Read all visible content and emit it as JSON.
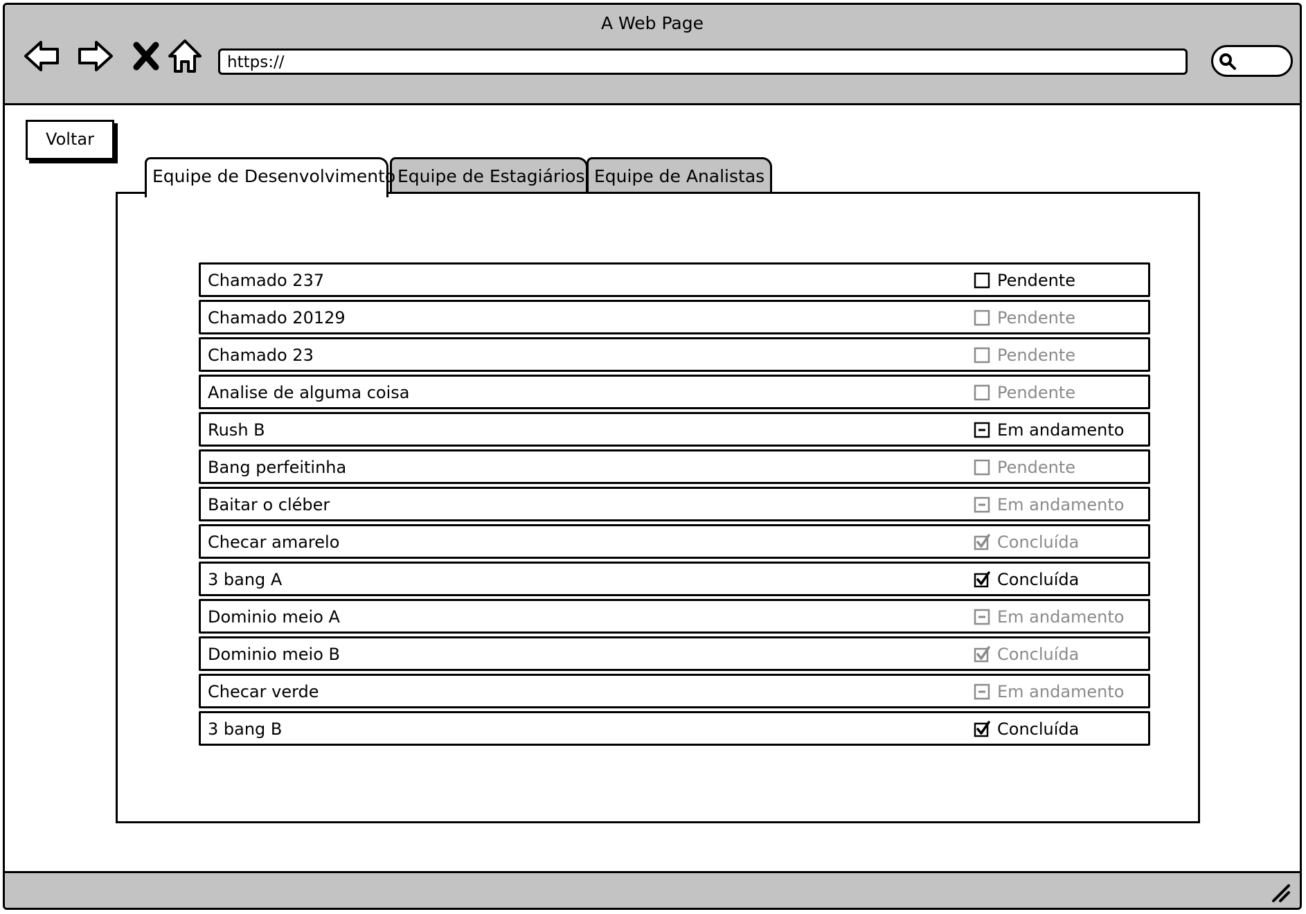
{
  "window": {
    "title": "A Web Page"
  },
  "address_bar": {
    "url": "https://"
  },
  "colors": {
    "chrome": "#c3c3c3",
    "border": "#000000",
    "dim_text": "#8a8a8a"
  },
  "back_button": {
    "label": "Voltar"
  },
  "tabs": [
    {
      "label": "Equipe de Desenvolvimento",
      "active": true
    },
    {
      "label": "Equipe de Estagiários",
      "active": false
    },
    {
      "label": "Equipe de Analistas",
      "active": false
    }
  ],
  "tickets": [
    {
      "name": "Chamado 237",
      "status": "Pendente",
      "state": "unchecked",
      "enabled": true
    },
    {
      "name": "Chamado 20129",
      "status": "Pendente",
      "state": "unchecked",
      "enabled": false
    },
    {
      "name": "Chamado 23",
      "status": "Pendente",
      "state": "unchecked",
      "enabled": false
    },
    {
      "name": "Analise de alguma coisa",
      "status": "Pendente",
      "state": "unchecked",
      "enabled": false
    },
    {
      "name": "Rush B",
      "status": "Em andamento",
      "state": "indeterminate",
      "enabled": true
    },
    {
      "name": "Bang perfeitinha",
      "status": "Pendente",
      "state": "unchecked",
      "enabled": false
    },
    {
      "name": "Baitar o cléber",
      "status": "Em andamento",
      "state": "indeterminate",
      "enabled": false
    },
    {
      "name": "Checar amarelo",
      "status": "Concluída",
      "state": "checked",
      "enabled": false
    },
    {
      "name": "3 bang A",
      "status": "Concluída",
      "state": "checked",
      "enabled": true
    },
    {
      "name": "Dominio meio A",
      "status": "Em andamento",
      "state": "indeterminate",
      "enabled": false
    },
    {
      "name": "Dominio meio B",
      "status": "Concluída",
      "state": "checked",
      "enabled": false
    },
    {
      "name": "Checar verde",
      "status": "Em andamento",
      "state": "indeterminate",
      "enabled": false
    },
    {
      "name": "3 bang B",
      "status": "Concluída",
      "state": "checked",
      "enabled": true
    }
  ]
}
